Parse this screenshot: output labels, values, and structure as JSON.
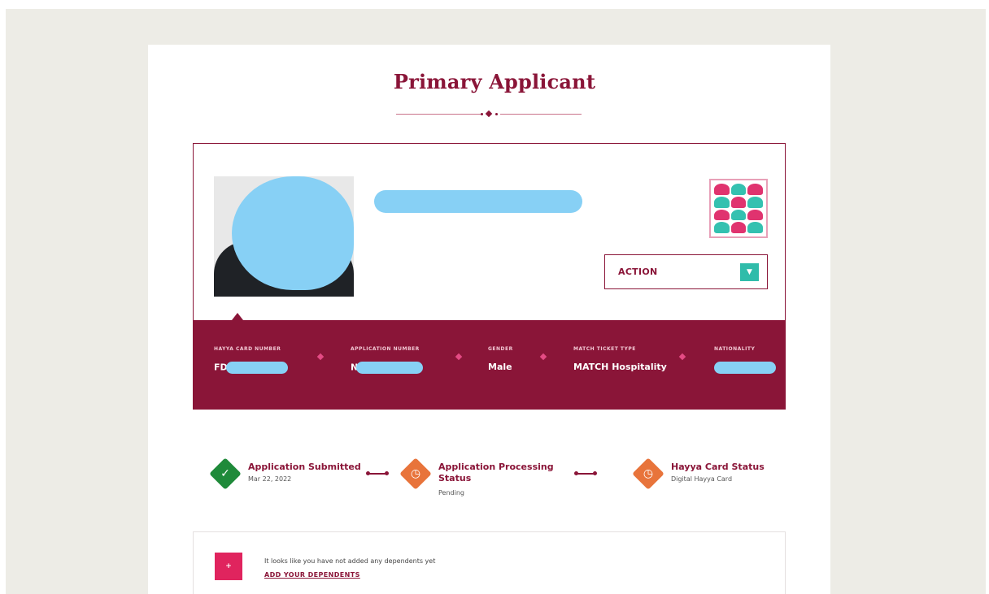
{
  "page": {
    "title": "Primary Applicant"
  },
  "profile": {
    "action_label": "ACTION",
    "fields": [
      {
        "label": "HAYYA CARD NUMBER",
        "value": "FD"
      },
      {
        "label": "APPLICATION NUMBER",
        "value": "N"
      },
      {
        "label": "GENDER",
        "value": "Male"
      },
      {
        "label": "MATCH TICKET TYPE",
        "value": "MATCH Hospitality"
      },
      {
        "label": "NATIONALITY",
        "value": ""
      }
    ]
  },
  "steps": [
    {
      "title": "Application Submitted",
      "subtitle": "Mar 22, 2022",
      "status": "complete",
      "color": "#1f8a3a"
    },
    {
      "title": "Application Processing Status",
      "subtitle": "Pending",
      "status": "pending",
      "color": "#e8743b"
    },
    {
      "title": "Hayya Card Status",
      "subtitle": "Digital Hayya Card",
      "status": "pending",
      "color": "#e8743b"
    }
  ],
  "dependents": {
    "message": "It looks like you have not added any dependents yet",
    "link": "ADD YOUR DEPENDENTS"
  },
  "colors": {
    "brand": "#8a1538",
    "accent": "#2fbcaa",
    "pink": "#e0245e",
    "complete": "#1f8a3a",
    "pending": "#e8743b"
  },
  "icons": {
    "action_caret": "chevron-down-icon",
    "complete": "check-icon",
    "pending": "clock-icon",
    "dependents": "add-user-icon",
    "qr": "qr-code-icon"
  }
}
